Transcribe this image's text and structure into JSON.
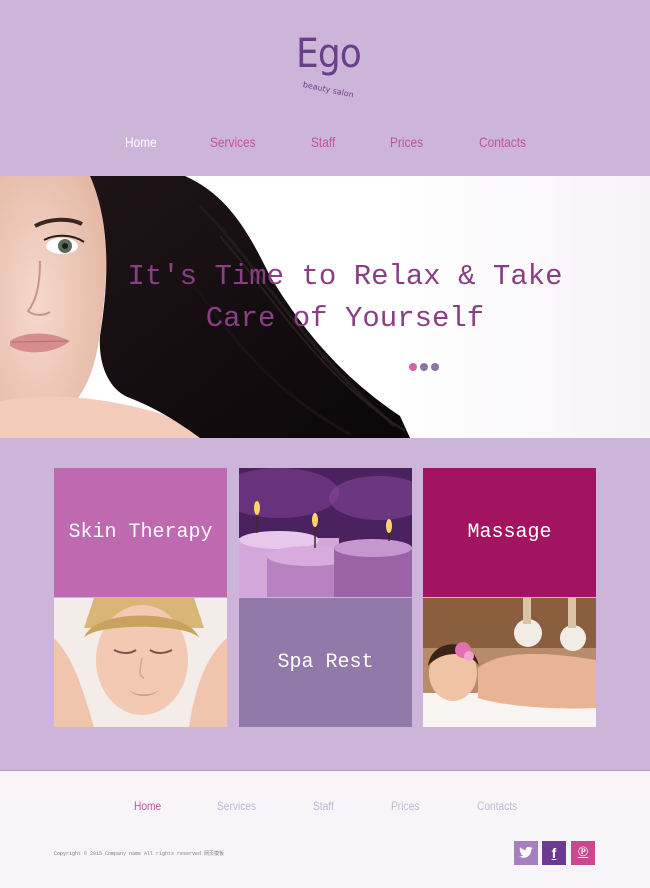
{
  "header": {
    "logo_word": "Ego",
    "logo_tagline": "beauty salon"
  },
  "nav": {
    "items": [
      {
        "label": "Home",
        "active": true
      },
      {
        "label": "Services",
        "active": false
      },
      {
        "label": "Staff",
        "active": false
      },
      {
        "label": "Prices",
        "active": false
      },
      {
        "label": "Contacts",
        "active": false
      }
    ]
  },
  "hero": {
    "title_line1": "It's Time to Relax & Take",
    "title_line2": "Care of Yourself",
    "slider": {
      "count": 3,
      "active_index": 0
    }
  },
  "tiles": {
    "skin": "Skin Therapy",
    "massage": "Massage",
    "spa": "Spa Rest"
  },
  "footer": {
    "nav": [
      {
        "label": "Home",
        "active": true
      },
      {
        "label": "Services",
        "active": false
      },
      {
        "label": "Staff",
        "active": false
      },
      {
        "label": "Prices",
        "active": false
      },
      {
        "label": "Contacts",
        "active": false
      }
    ],
    "copyright": "Copyright © 2015 Company name All rights reserved 网页模板",
    "social": {
      "twitter": "twitter-icon",
      "facebook": "facebook-icon",
      "pinterest": "pinterest-icon"
    }
  },
  "colors": {
    "background": "#cdb5d9",
    "accent_pink": "#c64f9c",
    "logo_purple": "#6a3f89",
    "hero_text": "#8a3e84",
    "massage_tile": "#a31460",
    "skin_tile": "#bf69b0",
    "spa_tile": "#917aa9"
  }
}
